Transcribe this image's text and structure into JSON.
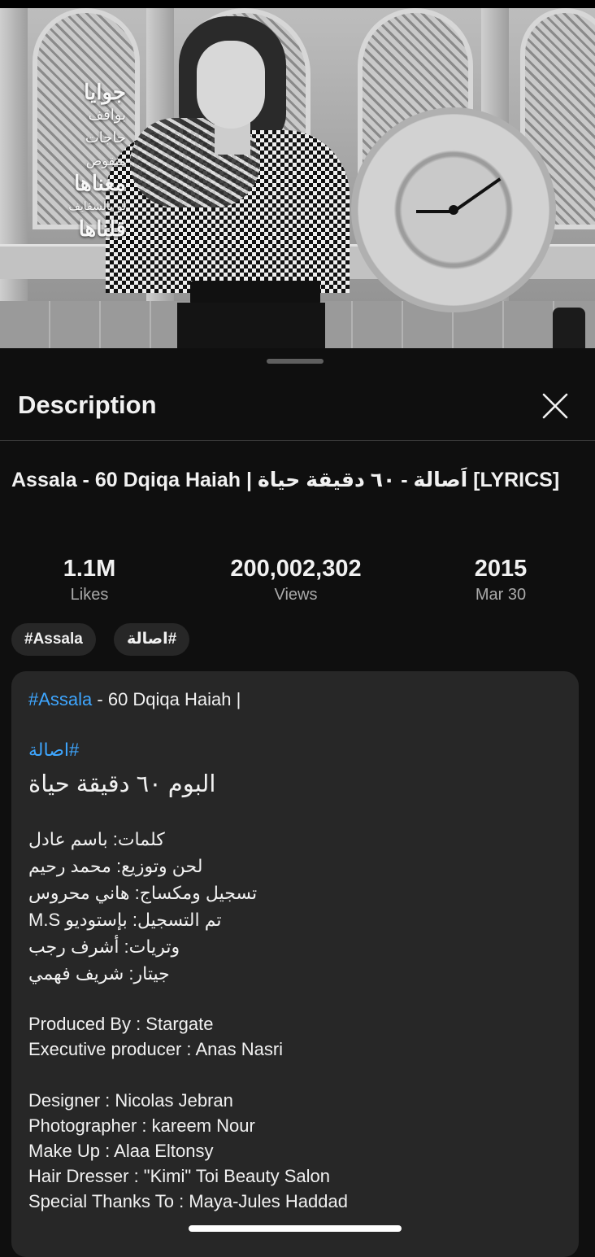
{
  "thumbnail": {
    "overlay_lyrics": [
      "جوايا",
      "بواقف",
      "حاجات",
      "منقوص",
      "معناها",
      "لو بالشفايف",
      "قلناها"
    ]
  },
  "sheet": {
    "title": "Description",
    "close_icon": "close-icon"
  },
  "video": {
    "title": "Assala - 60 Dqiqa Haiah | اَصالة - ٦٠ دقيقة حياة [LYRICS]",
    "stats": [
      {
        "value": "1.1M",
        "label": "Likes"
      },
      {
        "value": "200,002,302",
        "label": "Views"
      },
      {
        "value": "2015",
        "label": "Mar 30"
      }
    ],
    "hashtags": [
      "#Assala",
      "#اصالة"
    ]
  },
  "description": {
    "line1_hashtag": "#Assala",
    "line1_text": " - 60 Dqiqa Haiah |",
    "line2_hashtag": "#اصالة",
    "album": "البوم ٦٠ دقيقة حياة",
    "credits_ar": [
      "كلمات: باسم عادل",
      "لحن وتوزيع: محمد رحيم",
      "تسجيل ومكساج: هاني محروس",
      "تم التسجيل: بإستوديو M.S",
      "وتريات: أشرف رجب",
      "جيتار: شريف فهمي"
    ],
    "credits_en_1": [
      "Produced By : Stargate",
      "Executive producer : Anas Nasri"
    ],
    "credits_en_2": [
      "Designer : Nicolas Jebran",
      "Photographer : kareem Nour",
      "Make Up : Alaa Eltonsy",
      "Hair Dresser : \"Kimi\" Toi Beauty Salon",
      "Special Thanks To : Maya-Jules Haddad"
    ]
  }
}
